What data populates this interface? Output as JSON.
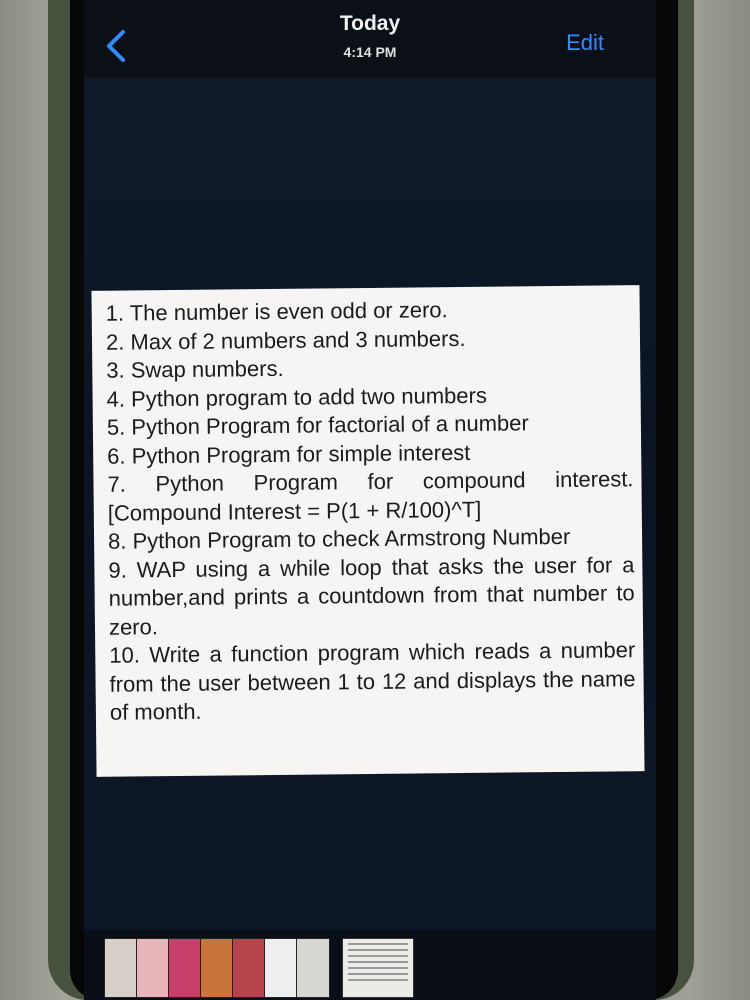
{
  "header": {
    "back_icon": "chevron-left-icon",
    "title": "Today",
    "subtitle": "4:14 PM",
    "edit_label": "Edit",
    "accent_color": "#2f8cff"
  },
  "photo": {
    "items": [
      "1. The number is even odd or zero.",
      "2. Max of 2 numbers and 3 numbers.",
      "3. Swap numbers.",
      "4. Python program to add two numbers",
      "5. Python Program for factorial of a number",
      "6. Python Program for simple interest",
      "7. Python Program for compound interest. [Compound Interest = P(1 + R/100)^T]",
      "8. Python Program to check Armstrong Number",
      "9. WAP using a while loop that asks the user for a number,and prints a countdown from that number to zero.",
      "10. Write a function program which reads a number from the user between 1 to 12 and displays the name of month."
    ]
  },
  "thumbnails": {
    "colors": [
      "#d9cfc9",
      "#e7b4b9",
      "#c6406b",
      "#c9743a",
      "#b7434d",
      "#eeeeee",
      "#d8d6d2"
    ]
  }
}
